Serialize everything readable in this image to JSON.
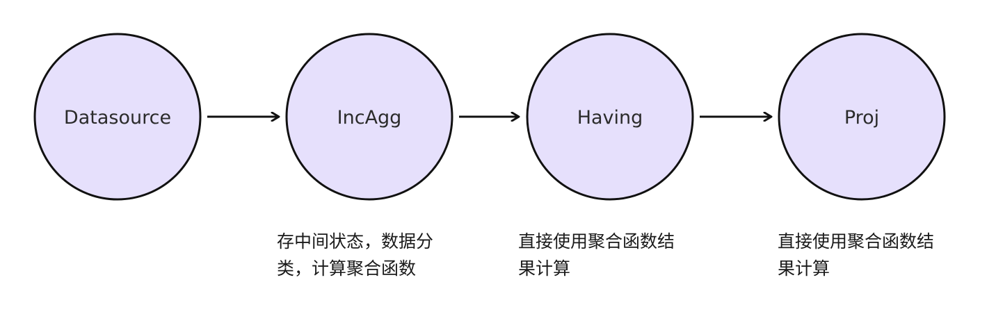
{
  "colors": {
    "node_fill": "#e6e0fc",
    "node_stroke": "#111111",
    "arrow": "#111111"
  },
  "nodes": [
    {
      "label": "Datasource"
    },
    {
      "label": "IncAgg"
    },
    {
      "label": "Having"
    },
    {
      "label": "Proj"
    }
  ],
  "descriptions": {
    "incagg": {
      "line1": "存中间状态，数据分",
      "line2": "类，计算聚合函数"
    },
    "having": {
      "line1": "直接使用聚合函数结",
      "line2": "果计算"
    },
    "proj": {
      "line1": "直接使用聚合函数结",
      "line2": "果计算"
    }
  }
}
